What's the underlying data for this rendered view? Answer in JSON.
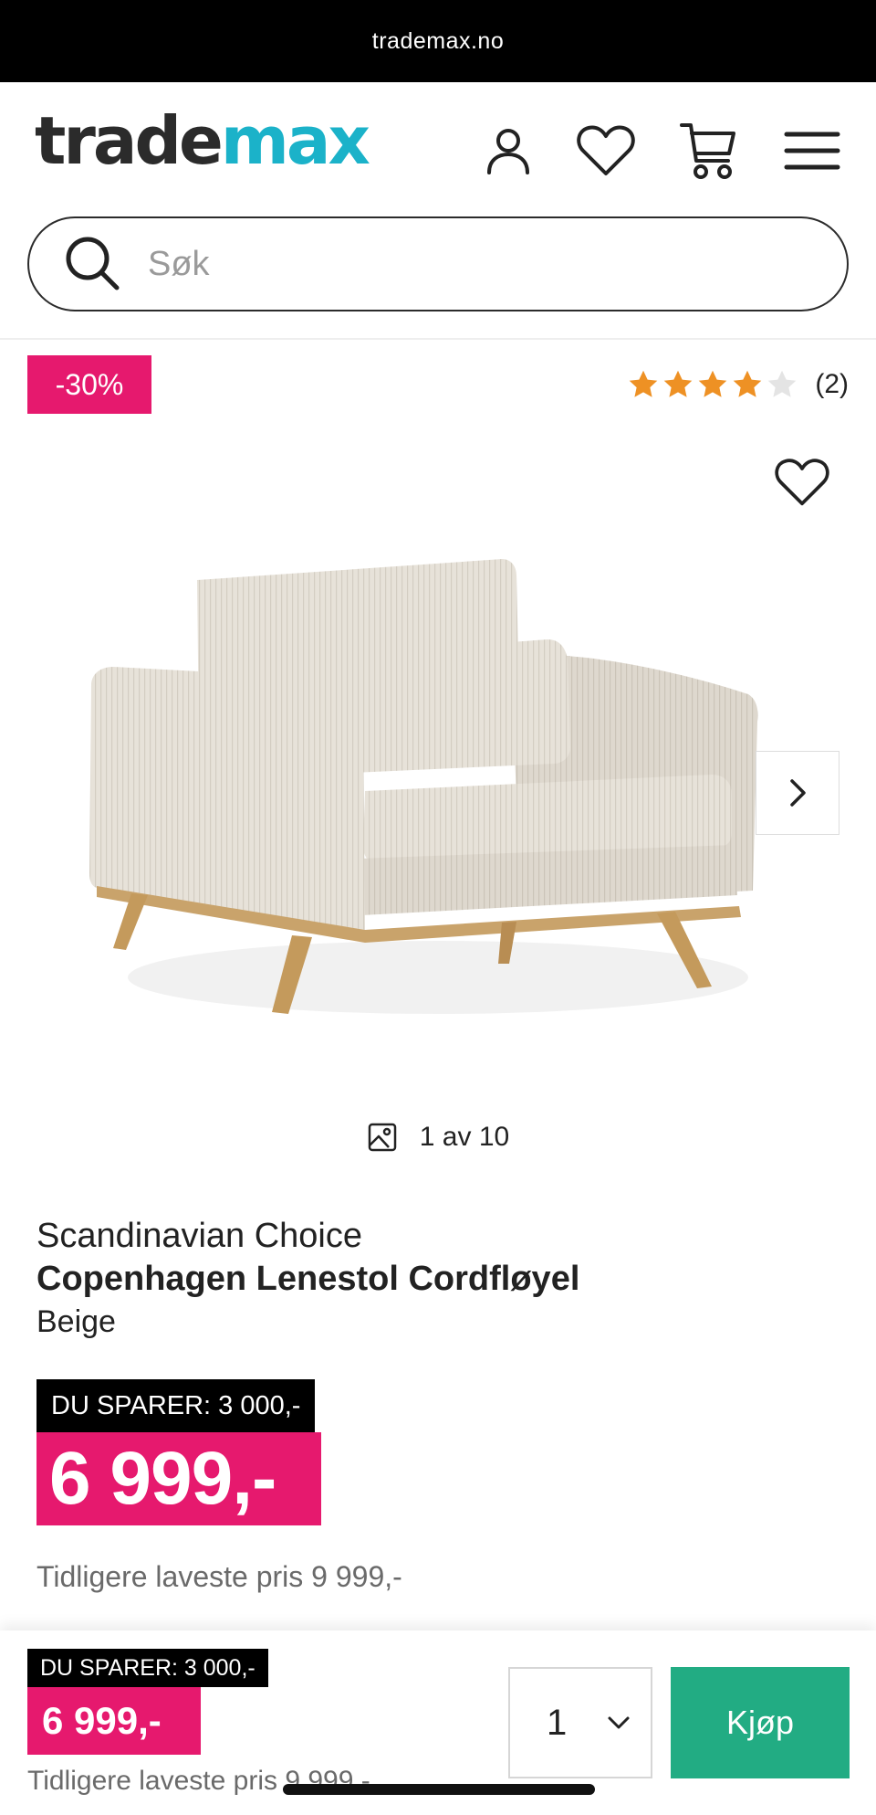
{
  "browser": {
    "url": "trademax.no"
  },
  "header": {
    "logo_part1": "trade",
    "logo_part2": "max",
    "icons": [
      "account-icon",
      "heart-icon",
      "cart-icon",
      "menu-icon"
    ]
  },
  "search": {
    "placeholder": "Søk"
  },
  "badge": {
    "discount": "-30%"
  },
  "rating": {
    "stars": 4,
    "max": 5,
    "count_label": "(2)"
  },
  "gallery": {
    "counter": "1 av 10"
  },
  "product": {
    "brand": "Scandinavian Choice",
    "name": "Copenhagen Lenestol Cordfløyel",
    "color": "Beige",
    "save_label": "DU SPARER: 3 000,-",
    "price": "6 999,-",
    "previous_price": "Tidligere laveste pris 9 999,-"
  },
  "sticky": {
    "save_label": "DU SPARER: 3 000,-",
    "price": "6 999,-",
    "previous_price": "Tidligere laveste pris 9 999,-",
    "quantity": "1",
    "buy_label": "Kjøp"
  },
  "colors": {
    "brand_pink": "#e6196e",
    "buy_green": "#22ac83",
    "logo_teal": "#1bb2c9",
    "star_orange": "#ee9124"
  }
}
